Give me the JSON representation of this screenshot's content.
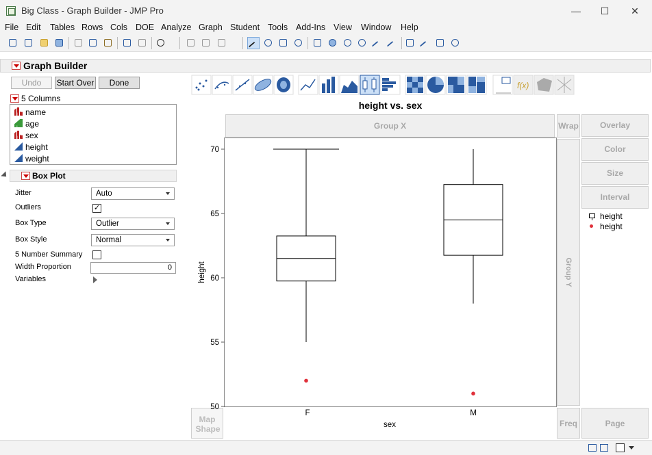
{
  "window": {
    "title": "Big Class - Graph Builder - JMP Pro",
    "minimize": "—",
    "maximize": "☐",
    "close": "✕"
  },
  "menu": [
    "File",
    "Edit",
    "Tables",
    "Rows",
    "Cols",
    "DOE",
    "Analyze",
    "Graph",
    "Student",
    "Tools",
    "Add-Ins",
    "View",
    "Window",
    "Help"
  ],
  "graph_builder": {
    "title": "Graph Builder",
    "buttons": {
      "undo": "Undo",
      "start_over": "Start Over",
      "done": "Done"
    },
    "columns_header": "5 Columns",
    "columns": [
      {
        "name": "name",
        "type": "nominal",
        "icon": "nominal-bars-icon"
      },
      {
        "name": "age",
        "type": "ordinal",
        "icon": "ordinal-bars-icon"
      },
      {
        "name": "sex",
        "type": "nominal",
        "icon": "nominal-bars-icon"
      },
      {
        "name": "height",
        "type": "continuous",
        "icon": "continuous-triangle-icon"
      },
      {
        "name": "weight",
        "type": "continuous",
        "icon": "continuous-triangle-icon"
      }
    ]
  },
  "box_plot": {
    "title": "Box Plot",
    "jitter_label": "Jitter",
    "jitter_value": "Auto",
    "outliers_label": "Outliers",
    "outliers_checked": true,
    "box_type_label": "Box Type",
    "box_type_value": "Outlier",
    "box_style_label": "Box Style",
    "box_style_value": "Normal",
    "five_number_label": "5 Number Summary",
    "five_number_checked": false,
    "width_proportion_label": "Width Proportion",
    "width_proportion_value": "0",
    "variables_label": "Variables"
  },
  "zones": {
    "group_x": "Group X",
    "wrap": "Wrap",
    "overlay": "Overlay",
    "color": "Color",
    "size": "Size",
    "interval": "Interval",
    "group_y": "Group Y",
    "map_shape": "Map Shape",
    "freq": "Freq",
    "page": "Page"
  },
  "legend": [
    {
      "label": "height",
      "marker": "box-icon"
    },
    {
      "label": "height",
      "marker": "red-dot",
      "color": "#e0303a"
    }
  ],
  "chart_data": {
    "type": "box",
    "title": "height vs. sex",
    "xlabel": "sex",
    "ylabel": "height",
    "ylim": [
      50,
      70
    ],
    "yticks": [
      50,
      55,
      60,
      65,
      70
    ],
    "categories": [
      "F",
      "M"
    ],
    "boxes": [
      {
        "category": "F",
        "whisker_low": 55,
        "q1": 59.75,
        "median": 61.5,
        "q3": 63.25,
        "whisker_high": 70,
        "outliers": [
          52
        ]
      },
      {
        "category": "M",
        "whisker_low": 58,
        "q1": 61.75,
        "median": 64.5,
        "q3": 67.25,
        "whisker_high": 70,
        "outliers": [
          51
        ]
      }
    ],
    "outlier_color": "#e0303a",
    "grid": false
  }
}
